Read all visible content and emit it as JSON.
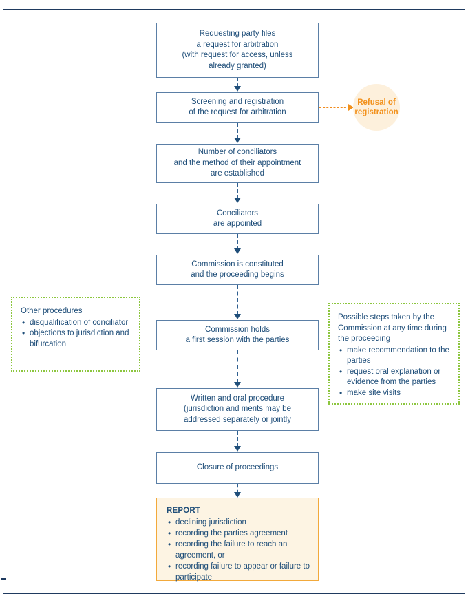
{
  "diagram": {
    "title": "Conciliation proceeding flowchart",
    "colors": {
      "rule": "#1f3a5f",
      "box_border": "#5b7fa6",
      "text": "#1f4e79",
      "connector": "#2f5f8f",
      "branch": "#f2911c",
      "circle_fill": "#fdf0dc",
      "note_border": "#8cc63e",
      "report_border": "#f2a93b",
      "report_fill": "#fdf4e3"
    },
    "nodes": [
      {
        "id": "request",
        "text": "Requesting party files\na request for arbitration\n(with request for access, unless\nalready granted)"
      },
      {
        "id": "screening",
        "text": "Screening and registration\nof the request for arbitration"
      },
      {
        "id": "conciliators-number",
        "text": "Number of conciliators\nand the method of their appointment\nare established"
      },
      {
        "id": "conciliators-appointed",
        "text": "Conciliators\nare appointed"
      },
      {
        "id": "commission-constituted",
        "text": "Commission is constituted\nand the proceeding begins"
      },
      {
        "id": "first-session",
        "text": "Commission holds\na first session with the parties"
      },
      {
        "id": "written-oral",
        "text": "Written and oral procedure\n(jurisdiction and merits may be\naddressed separately or jointly"
      },
      {
        "id": "closure",
        "text": "Closure of proceedings"
      }
    ],
    "refusal": {
      "label": "Refusal of\nregistration"
    },
    "note_left": {
      "title": "Other procedures",
      "items": [
        "disqualification of conciliator",
        "objections to jurisdiction and bifurcation"
      ]
    },
    "note_right": {
      "title": "Possible steps taken by the Commission at any time during the proceeding",
      "items": [
        "make recommendation to the parties",
        "request oral explanation or evidence from the parties",
        "make site visits"
      ]
    },
    "report": {
      "title": "REPORT",
      "items": [
        "declining jurisdiction",
        "recording the parties agreement",
        "recording the failure to reach an agreement, or",
        "recording failure to appear or failure to participate"
      ]
    }
  }
}
